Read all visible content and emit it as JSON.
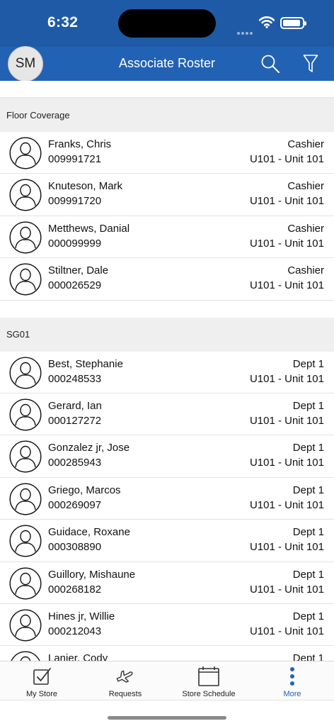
{
  "status_bar": {
    "time": "6:32",
    "cellular_icon": "cellular-dots-icon",
    "wifi_icon": "wifi-icon",
    "battery_icon": "battery-icon"
  },
  "nav": {
    "avatar_initials": "SM",
    "title": "Associate Roster",
    "search_icon": "search-icon",
    "filter_icon": "filter-icon",
    "background": "#2262b4"
  },
  "sections": [
    {
      "title": "Floor Coverage",
      "associates": [
        {
          "name": "Franks, Chris",
          "id": "009991721",
          "role": "Cashier",
          "unit": "U101 - Unit 101"
        },
        {
          "name": "Knuteson, Mark",
          "id": "009991720",
          "role": "Cashier",
          "unit": "U101 - Unit 101"
        },
        {
          "name": "Metthews, Danial",
          "id": "000099999",
          "role": "Cashier",
          "unit": "U101 - Unit 101"
        },
        {
          "name": "Stiltner, Dale",
          "id": "000026529",
          "role": "Cashier",
          "unit": "U101 - Unit 101"
        }
      ]
    },
    {
      "title": "SG01",
      "associates": [
        {
          "name": "Best, Stephanie",
          "id": "000248533",
          "role": "Dept 1",
          "unit": "U101 - Unit 101"
        },
        {
          "name": "Gerard, Ian",
          "id": "000127272",
          "role": "Dept 1",
          "unit": "U101 - Unit 101"
        },
        {
          "name": "Gonzalez jr, Jose",
          "id": "000285943",
          "role": "Dept 1",
          "unit": "U101 - Unit 101"
        },
        {
          "name": "Griego, Marcos",
          "id": "000269097",
          "role": "Dept 1",
          "unit": "U101 - Unit 101"
        },
        {
          "name": "Guidace, Roxane",
          "id": "000308890",
          "role": "Dept 1",
          "unit": "U101 - Unit 101"
        },
        {
          "name": "Guillory, Mishaune",
          "id": "000268182",
          "role": "Dept 1",
          "unit": "U101 - Unit 101"
        },
        {
          "name": "Hines jr, Willie",
          "id": "000212043",
          "role": "Dept 1",
          "unit": "U101 - Unit 101"
        },
        {
          "name": "Lanier, Cody",
          "id": "",
          "role": "Dept 1",
          "unit": ""
        }
      ]
    }
  ],
  "tabs": [
    {
      "label": "My Store",
      "icon": "checkbox-icon",
      "active": false
    },
    {
      "label": "Requests",
      "icon": "airplane-icon",
      "active": false
    },
    {
      "label": "Store Schedule",
      "icon": "calendar-icon",
      "active": false
    },
    {
      "label": "More",
      "icon": "vertical-dots-icon",
      "active": true
    }
  ],
  "colors": {
    "status_bar": "#1f5aa6",
    "nav_bar": "#2262b4",
    "accent": "#2262b4",
    "section_header": "#efefef"
  }
}
